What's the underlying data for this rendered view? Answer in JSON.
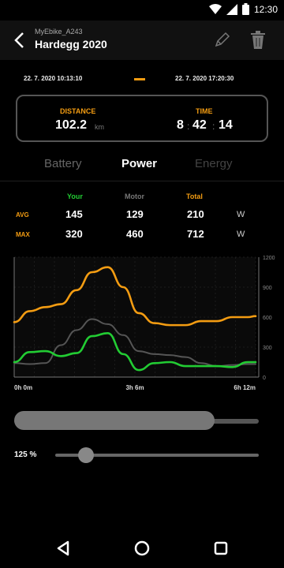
{
  "status_bar": {
    "time": "12:30",
    "icons": [
      "wifi-icon",
      "signal-icon",
      "battery-icon"
    ]
  },
  "header": {
    "bike_name": "MyEbike_A243",
    "ride_title": "Hardegg 2020",
    "actions": [
      "edit-icon",
      "delete-icon"
    ]
  },
  "date_range": {
    "start": "22. 7. 2020 10:13:10",
    "end": "22. 7. 2020 17:20:30"
  },
  "summary": {
    "distance_label": "DISTANCE",
    "distance_value": "102.2",
    "distance_unit": "km",
    "time_label": "TIME",
    "time_hours": "8",
    "time_minutes": "42",
    "time_seconds": "14"
  },
  "tabs": [
    {
      "label": "Battery",
      "active": false
    },
    {
      "label": "Power",
      "active": true
    },
    {
      "label": "Energy",
      "active": false
    }
  ],
  "stats": {
    "columns": [
      "Your",
      "Motor",
      "Total"
    ],
    "rows": [
      {
        "label": "AVG",
        "values": [
          "145",
          "129",
          "210"
        ],
        "unit": "W"
      },
      {
        "label": "MAX",
        "values": [
          "320",
          "460",
          "712"
        ],
        "unit": "W"
      }
    ]
  },
  "colors": {
    "accent": "#f39c12",
    "your": "#22cc33",
    "motor": "#555555",
    "total": "#f39c12"
  },
  "chart_data": {
    "type": "line",
    "x_tick_labels": [
      "0h 0m",
      "3h 6m",
      "6h 12m"
    ],
    "y_ticks": [
      0,
      300,
      600,
      900,
      1200
    ],
    "ylim": [
      0,
      1200
    ],
    "xlim": [
      0,
      372
    ],
    "y_tick_labels": [
      "0",
      "300",
      "600",
      "900",
      "1200"
    ],
    "x": [
      0,
      24,
      48,
      72,
      96,
      120,
      144,
      168,
      192,
      216,
      240,
      264,
      288,
      312,
      336,
      360,
      372
    ],
    "series": [
      {
        "color": "#f39c12",
        "values": [
          550,
          660,
          700,
          730,
          870,
          1050,
          1100,
          900,
          640,
          540,
          520,
          520,
          560,
          560,
          600,
          600,
          610
        ]
      },
      {
        "color": "#22cc33",
        "values": [
          150,
          250,
          260,
          210,
          240,
          410,
          440,
          230,
          70,
          140,
          150,
          110,
          110,
          110,
          100,
          150,
          150
        ]
      },
      {
        "color": "#555555",
        "values": [
          140,
          130,
          140,
          320,
          470,
          580,
          530,
          420,
          260,
          230,
          220,
          200,
          140,
          110,
          120,
          130,
          130
        ]
      }
    ]
  },
  "progress": {
    "fill": 0.82
  },
  "zoom": {
    "label": "125 %",
    "level": 0.15
  },
  "nav": [
    "back-triangle-icon",
    "home-circle-icon",
    "recents-square-icon"
  ]
}
